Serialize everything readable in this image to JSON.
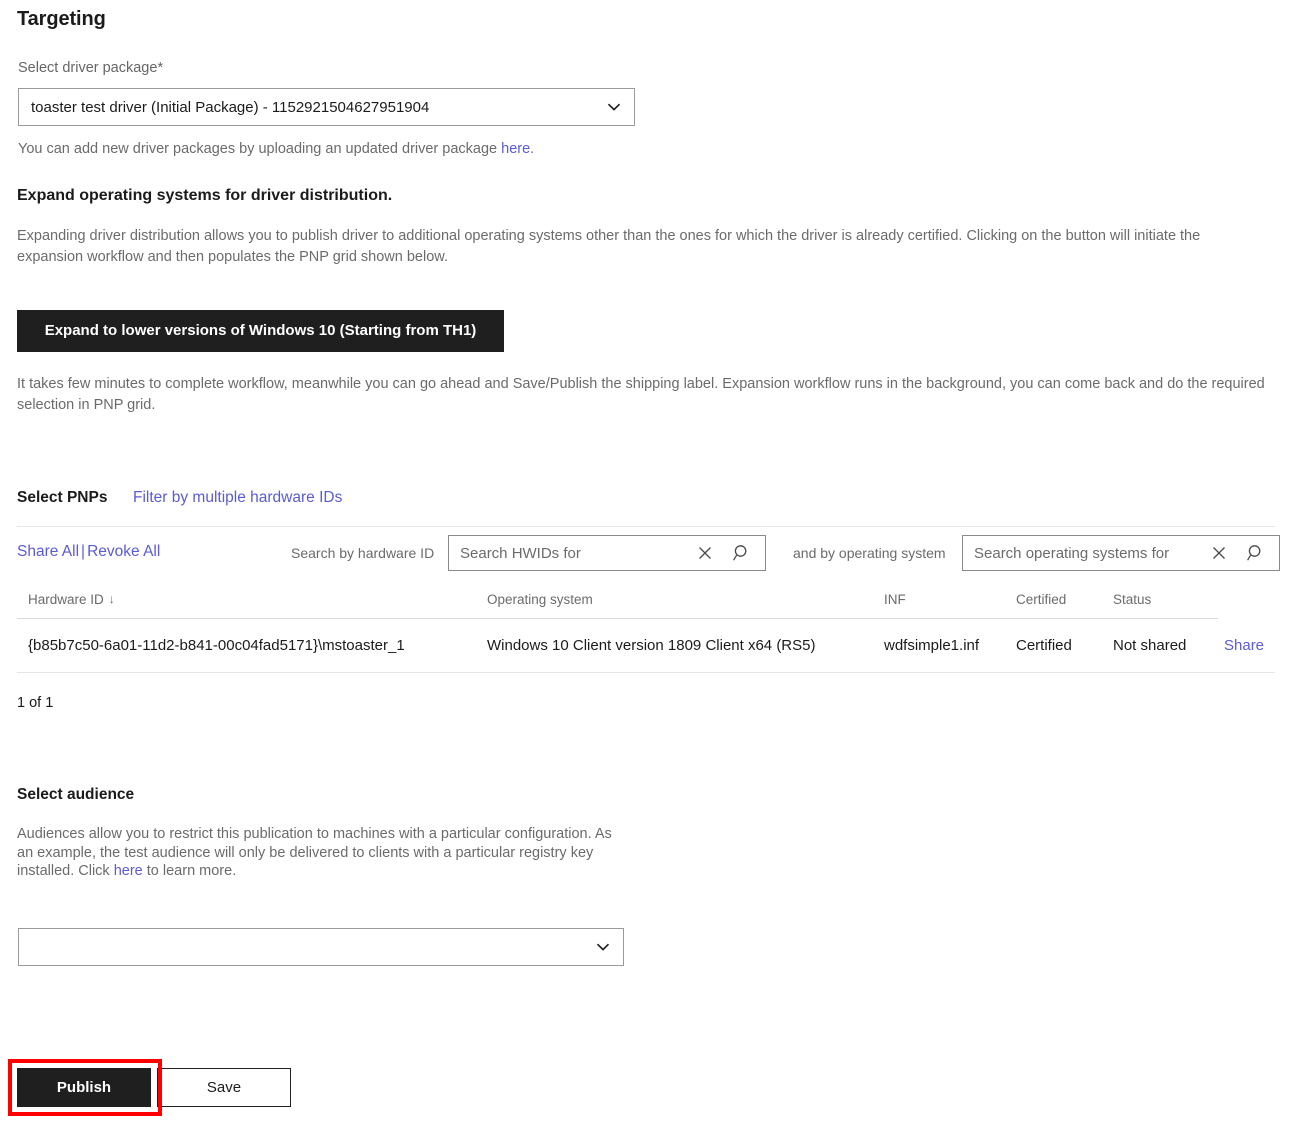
{
  "page": {
    "title": "Targeting"
  },
  "driver_package": {
    "label": "Select driver package",
    "required_marker": "*",
    "selected_value": "toaster test driver (Initial Package) - 1152921504627951904",
    "helper_before_link": "You can add new driver packages by uploading an updated driver package ",
    "helper_link": "here",
    "helper_after_link": "."
  },
  "expand_section": {
    "heading": "Expand operating systems for driver distribution.",
    "description": "Expanding driver distribution allows you to publish driver to additional operating systems other than the ones for which the driver is already certified. Clicking on the button will initiate the expansion workflow and then populates the PNP grid shown below.",
    "button_label": "Expand to lower versions of Windows 10 (Starting from TH1)",
    "note": "It takes few minutes to complete workflow, meanwhile you can go ahead and Save/Publish the shipping label. Expansion workflow runs in the background, you can come back and do the required selection in PNP grid."
  },
  "pnp_section": {
    "heading": "Select PNPs",
    "filter_link": "Filter by multiple hardware IDs",
    "toolbar": {
      "share_all": "Share All",
      "separator": "|",
      "revoke_all": "Revoke All",
      "search_hwid_prefix": "Search by hardware ID",
      "search_hwid_placeholder": "Search HWIDs for",
      "search_hwid_value": "",
      "search_os_prefix": "and by operating system",
      "search_os_placeholder": "Search operating systems for",
      "search_os_value": "",
      "clear_icon": "close-x-icon",
      "search_icon": "magnifier-icon"
    },
    "grid": {
      "columns": [
        "Hardware ID",
        "Operating system",
        "INF",
        "Certified",
        "Status",
        ""
      ],
      "sort_column": "Hardware ID",
      "sort_direction_glyph": "↓",
      "rows": [
        {
          "hardware_id": "{b85b7c50-6a01-11d2-b841-00c04fad5171}\\mstoaster_1",
          "operating_system": "Windows 10 Client version 1809 Client x64 (RS5)",
          "inf": "wdfsimple1.inf",
          "certified": "Certified",
          "status": "Not shared",
          "action": "Share"
        }
      ],
      "count_text": "1 of 1"
    }
  },
  "audience_section": {
    "heading": "Select audience",
    "description_before_link": "Audiences allow you to restrict this publication to machines with a particular configuration. As an example, the test audience will only be delivered to clients with a particular registry key installed. Click ",
    "description_link": "here",
    "description_after_link": " to learn more.",
    "selected_value": ""
  },
  "footer": {
    "publish_label": "Publish",
    "save_label": "Save"
  },
  "colors": {
    "link": "#5b5bd6",
    "dark_button": "#1f1f1f",
    "highlight": "#ff0000",
    "muted_text": "#6b6b6b",
    "rule": "#e6e6e6"
  }
}
